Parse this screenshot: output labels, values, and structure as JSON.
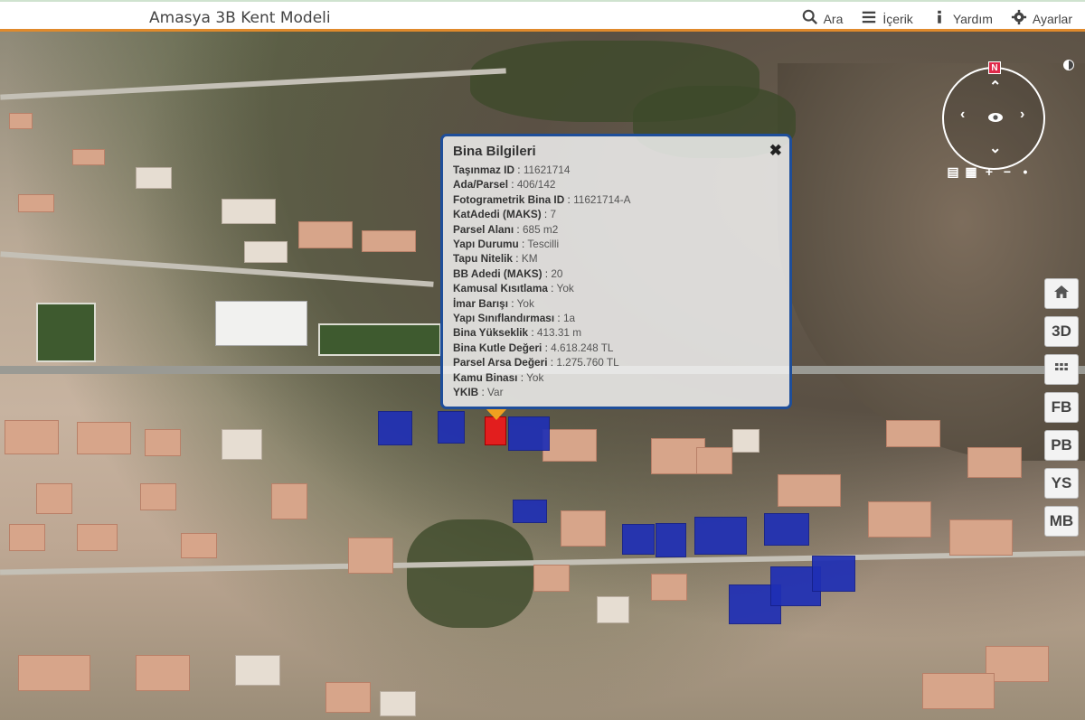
{
  "header": {
    "title": "Amasya 3B Kent Modeli",
    "nav": {
      "search": "Ara",
      "content": "İçerik",
      "help": "Yardım",
      "settings": "Ayarlar"
    }
  },
  "popup": {
    "title": "Bina Bilgileri",
    "close": "✖",
    "rows": [
      {
        "key": "Taşınmaz ID",
        "value": "11621714"
      },
      {
        "key": "Ada/Parsel",
        "value": "406/142"
      },
      {
        "key": "Fotogrametrik Bina ID",
        "value": "11621714-A"
      },
      {
        "key": "KatAdedi (MAKS)",
        "value": "7"
      },
      {
        "key": "Parsel Alanı",
        "value": "685 m2"
      },
      {
        "key": "Yapı Durumu",
        "value": "Tescilli"
      },
      {
        "key": "Tapu Nitelik",
        "value": "KM"
      },
      {
        "key": "BB Adedi (MAKS)",
        "value": "20"
      },
      {
        "key": "Kamusal Kısıtlama",
        "value": "Yok"
      },
      {
        "key": "İmar Barışı",
        "value": "Yok"
      },
      {
        "key": "Yapı Sınıflandırması",
        "value": "1a"
      },
      {
        "key": "Bina Yükseklik",
        "value": "413.31 m"
      },
      {
        "key": "Bina Kutle Değeri",
        "value": "4.618.248 TL"
      },
      {
        "key": "Parsel Arsa Değeri",
        "value": "1.275.760 TL"
      },
      {
        "key": "Kamu Binası",
        "value": "Yok"
      },
      {
        "key": "YKIB",
        "value": "Var"
      }
    ]
  },
  "compass": {
    "north": "N"
  },
  "side_buttons": {
    "btn_3d": "3D",
    "btn_fb": "FB",
    "btn_pb": "PB",
    "btn_ys": "YS",
    "btn_mb": "MB"
  },
  "colors": {
    "accent": "#e08a2c",
    "popup_border": "#1e4e9a",
    "highlight_building": "#e21e1e",
    "selected_buildings": "#1f2fb5"
  },
  "icons": {
    "search": "search-icon",
    "content": "list-icon",
    "help": "info-icon",
    "settings": "gear-icon",
    "home": "home-icon",
    "grid": "grid-icon"
  }
}
